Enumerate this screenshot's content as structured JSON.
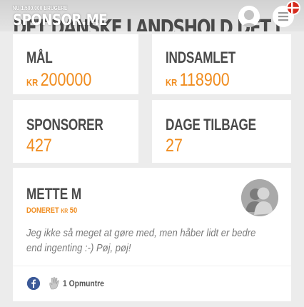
{
  "header": {
    "users_count": "NU 1.500.000 BRUGERE",
    "logo": "SPONSOR.ME",
    "background_title": "DET DANSKE LANDSHOLD DET L"
  },
  "stats": {
    "goal": {
      "label": "MÅL",
      "currency": "KR",
      "value": "200000"
    },
    "raised": {
      "label": "INDSAMLET",
      "currency": "KR",
      "value": "118900"
    },
    "sponsors": {
      "label": "SPONSORER",
      "value": "427"
    },
    "days": {
      "label": "DAGE TILBAGE",
      "value": "27"
    }
  },
  "comment": {
    "name": "METTE M",
    "donated_label": "DONERET",
    "currency": "KR",
    "amount": "50",
    "message": "Jeg ikke så meget at gøre med, men håber lidt er bedre end ingenting :-) Pøj, pøj!",
    "cheer_label": "1 Opmuntre"
  },
  "colors": {
    "accent": "#f08c1e",
    "text_dark": "#4a4a4a",
    "facebook": "#3b5998",
    "flag_red": "#d52b1e"
  },
  "icons": [
    "user-icon",
    "menu-icon",
    "danish-flag-icon",
    "avatar-placeholder-icon",
    "facebook-icon",
    "cheer-hand-icon"
  ]
}
